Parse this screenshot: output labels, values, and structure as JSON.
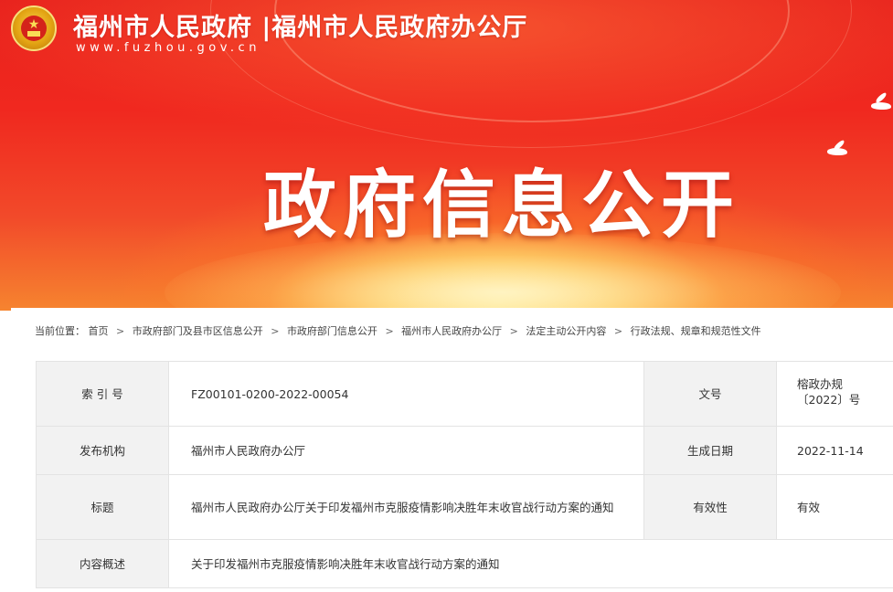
{
  "header": {
    "site_title": "福州市人民政府 |福州市人民政府办公厅",
    "site_url": "www.fuzhou.gov.cn",
    "banner_heading": "政府信息公开",
    "colors": {
      "banner_red": "#e8211d",
      "banner_glow": "#ffe9a0",
      "text": "#ffffff"
    }
  },
  "breadcrumb": {
    "label": "当前位置：",
    "separator": ">",
    "items": [
      "首页",
      "市政府部门及县市区信息公开",
      "市政府部门信息公开",
      "福州市人民政府办公厅",
      "法定主动公开内容",
      "行政法规、规章和规范性文件"
    ]
  },
  "info": {
    "index_label": "索 引 号",
    "index_value": "FZ00101-0200-2022-00054",
    "docnum_label": "文号",
    "docnum_value": "榕政办规〔2022〕号",
    "publisher_label": "发布机构",
    "publisher_value": "福州市人民政府办公厅",
    "date_label": "生成日期",
    "date_value": "2022-11-14",
    "title_label": "标题",
    "title_value": "福州市人民政府办公厅关于印发福州市克服疫情影响决胜年末收官战行动方案的通知",
    "validity_label": "有效性",
    "validity_value": "有效",
    "summary_label": "内容概述",
    "summary_value": "关于印发福州市克服疫情影响决胜年末收官战行动方案的通知"
  }
}
